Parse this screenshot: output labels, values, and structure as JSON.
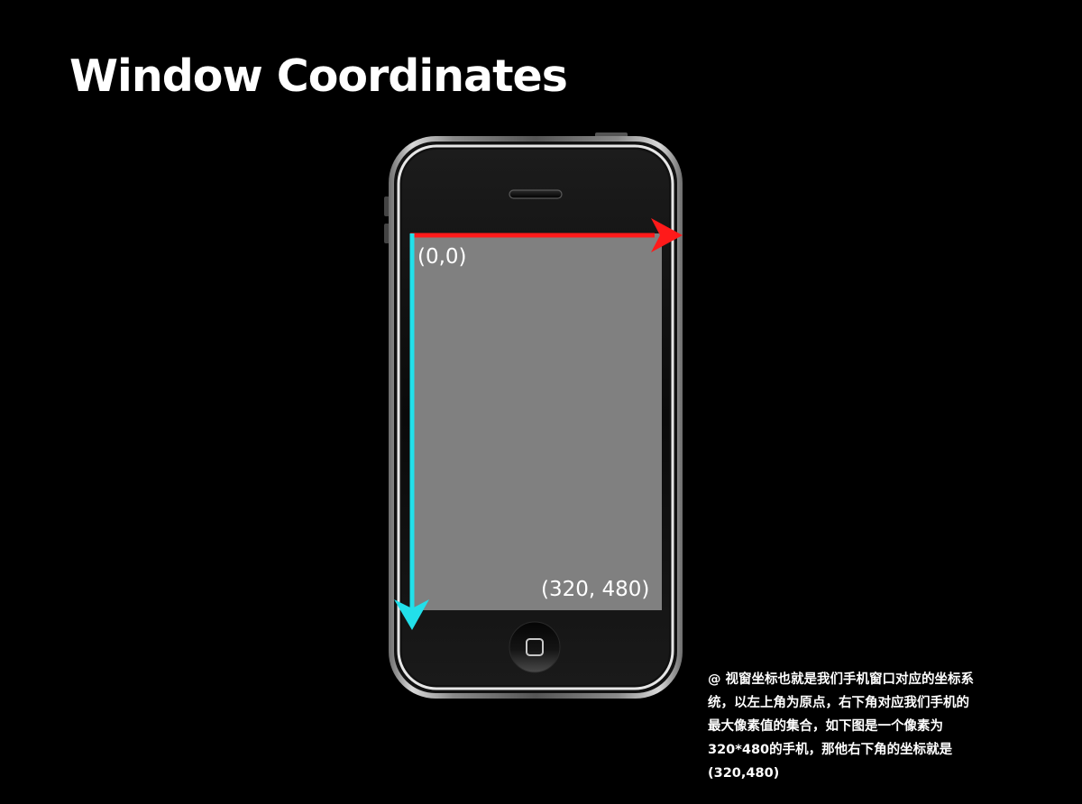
{
  "slide": {
    "title": "Window Coordinates"
  },
  "diagram": {
    "origin_label": "(0,0)",
    "corner_label": "(320, 480)",
    "x_axis_color": "#ff1a1a",
    "y_axis_color": "#22e0ea",
    "screen_color": "#808080"
  },
  "caption": {
    "lines": [
      "@ 视窗坐标也就是我们手机窗口对应的坐标系",
      "统，以左上角为原点，右下角对应我们手机的",
      "最大像素值的集合，如下图是一个像素为",
      "320*480的手机，那他右下角的坐标就是",
      "(320,480)"
    ]
  }
}
